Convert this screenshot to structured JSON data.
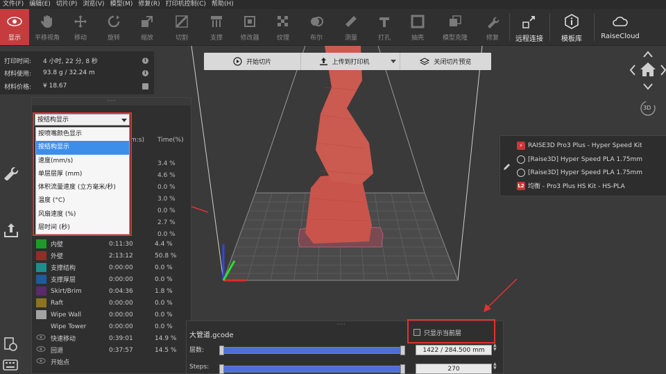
{
  "menu": [
    "文件(F)",
    "编辑(E)",
    "切片(P)",
    "浏览(V)",
    "模型(M)",
    "修复(R)",
    "打印机控制(C)",
    "帮助(H)"
  ],
  "toolbar": {
    "tools": [
      "显示",
      "平移视角",
      "移动",
      "旋转",
      "缩放",
      "切割",
      "支撑",
      "修改器",
      "纹理",
      "布尔",
      "测量",
      "打孔",
      "抽壳",
      "模型克隆",
      "修复"
    ],
    "remote": "远程连接",
    "model_lib": "模板库",
    "cloud": "RaiseCloud"
  },
  "print_info": {
    "rows": [
      {
        "label": "打印时间:",
        "value": "4 小时, 22 分, 8 秒"
      },
      {
        "label": "材料使用:",
        "value": "93.8 g / 32.24 m"
      },
      {
        "label": "材料价格:",
        "value": "¥ 18.67"
      }
    ]
  },
  "slice_bar": {
    "start": "开始切片",
    "upload": "上传到打印机",
    "close_preview": "关闭切片预览"
  },
  "nav": {
    "view3d": "3D"
  },
  "stats": {
    "grip": "·····",
    "col_time_partial": "m:s)",
    "col_pct": "Time(%)",
    "hidden_pcts": [
      "3.4 %",
      "4.6 %",
      "0.0 %",
      "3.0 %",
      "0.0 %",
      "2.7 %",
      "0.0 %"
    ],
    "rows": [
      {
        "name": "内壁",
        "time": "0:11:30",
        "pct": "4.4 %",
        "color": "#1f9a2a"
      },
      {
        "name": "外壁",
        "time": "2:13:12",
        "pct": "50.8 %",
        "color": "#8e2f2a"
      },
      {
        "name": "支撑结构",
        "time": "0:00:00",
        "pct": "0.0 %",
        "color": "#1d8d8d"
      },
      {
        "name": "支撑厚层",
        "time": "0:00:00",
        "pct": "0.0 %",
        "color": "#1f5a9a"
      },
      {
        "name": "Skirt/Brim",
        "time": "0:04:36",
        "pct": "1.8 %",
        "color": "#5a2a6a"
      },
      {
        "name": "Raft",
        "time": "0:00:00",
        "pct": "0.0 %",
        "color": "#8a7420"
      },
      {
        "name": "Wipe Wall",
        "time": "0:00:00",
        "pct": "0.0 %",
        "color": "#a3a3a3"
      },
      {
        "name": "Wipe Tower",
        "time": "0:00:00",
        "pct": "0.0 %",
        "color": "#2f2f2f"
      },
      {
        "name": "快速移动",
        "time": "0:39:01",
        "pct": "14.9 %",
        "color": "eye"
      },
      {
        "name": "回退",
        "time": "0:37:57",
        "pct": "14.5 %",
        "color": "eye"
      },
      {
        "name": "开始点",
        "time": "",
        "pct": "",
        "color": "eye"
      }
    ]
  },
  "dropdown": {
    "selected": "按结构显示",
    "options": [
      "按喷嘴颜色显示",
      "按结构显示",
      "速度(mm/s)",
      "单层层厚 (mm)",
      "体积流量速度 (立方毫米/秒)",
      "温度 (°C)",
      "风扇速度 (%)",
      "层时间 (秒)"
    ]
  },
  "materials": [
    {
      "text": "RAISE3D Pro3 Plus - Hyper Speed Kit",
      "icon": "printer-icon"
    },
    {
      "text": "[Raise3D] Hyper Speed PLA 1.75mm",
      "icon": "filament-icon"
    },
    {
      "text": "[Raise3D] Hyper Speed PLA 1.75mm",
      "icon": "filament-icon"
    },
    {
      "text": "均衡 - Pro3 Plus HS Kit - HS-PLA",
      "icon": "l2-icon"
    }
  ],
  "material_badge": "L2",
  "gcode": {
    "file": "大管道.gcode",
    "grip": "·····",
    "layer_label": "层数:",
    "layer_value": "1422 / 284.500 mm",
    "steps_label": "Steps:",
    "steps_value": "270",
    "only_current": "只显示当前层"
  },
  "colors": {
    "accent": "#c63b3e",
    "highlight": "#e5312f",
    "slider": "#4d6fd6"
  }
}
